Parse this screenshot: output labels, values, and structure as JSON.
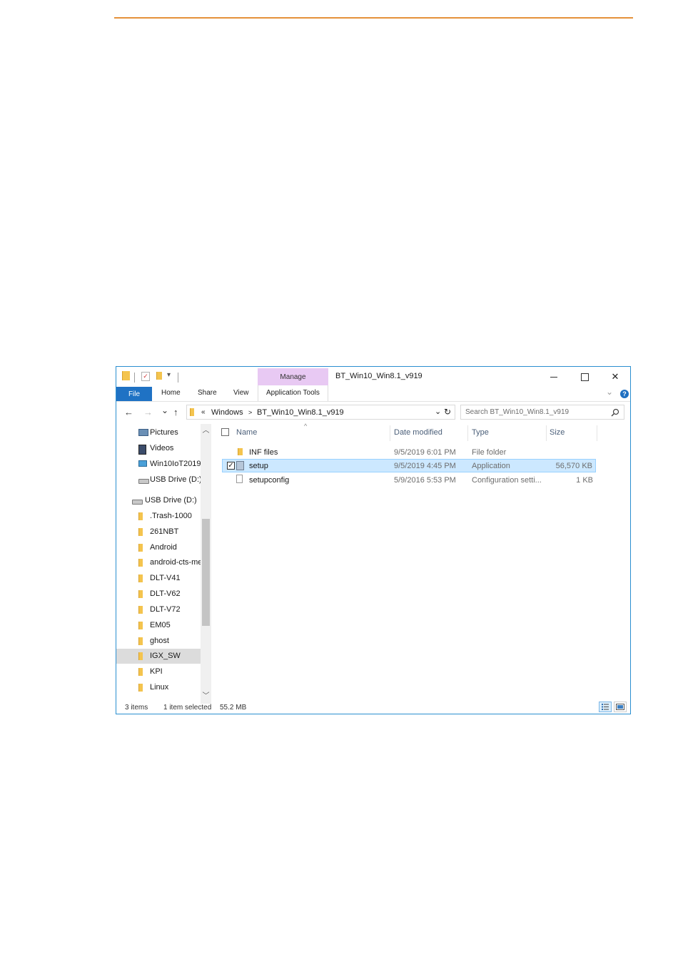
{
  "window": {
    "title": "BT_Win10_Win8.1_v919",
    "contextual_tab_group": "Manage",
    "ribbon_tabs": [
      "File",
      "Home",
      "Share",
      "View",
      "Application Tools"
    ],
    "help_label": "?"
  },
  "nav": {
    "back": "←",
    "forward": "→",
    "recent": "⌄",
    "up": "↑",
    "path_overflow": "«",
    "crumbs": [
      "Windows",
      "BT_Win10_Win8.1_v919"
    ],
    "crumb_sep": ">",
    "refresh": "↻",
    "search_placeholder": "Search BT_Win10_Win8.1_v919",
    "search_icon": "magnifier-icon"
  },
  "nav_pane": {
    "items": [
      {
        "label": "Pictures",
        "icon": "pictures-icon"
      },
      {
        "label": "Videos",
        "icon": "videos-icon"
      },
      {
        "label": "Win10IoT2019",
        "icon": "network-drive-icon"
      },
      {
        "label": "USB Drive (D:)",
        "icon": "usb-drive-icon"
      },
      {
        "label": "USB Drive (D:)",
        "icon": "usb-drive-icon"
      },
      {
        "label": ".Trash-1000",
        "icon": "folder-icon"
      },
      {
        "label": "261NBT",
        "icon": "folder-icon"
      },
      {
        "label": "Android",
        "icon": "folder-icon"
      },
      {
        "label": "android-cts-media",
        "icon": "folder-icon"
      },
      {
        "label": "DLT-V41",
        "icon": "folder-icon"
      },
      {
        "label": "DLT-V62",
        "icon": "folder-icon"
      },
      {
        "label": "DLT-V72",
        "icon": "folder-icon"
      },
      {
        "label": "EM05",
        "icon": "folder-icon"
      },
      {
        "label": "ghost",
        "icon": "folder-icon"
      },
      {
        "label": "IGX_SW",
        "icon": "folder-icon"
      },
      {
        "label": "KPI",
        "icon": "folder-icon"
      },
      {
        "label": "Linux",
        "icon": "folder-icon"
      }
    ],
    "selected": "IGX_SW"
  },
  "file_list": {
    "columns": [
      "Name",
      "Date modified",
      "Type",
      "Size"
    ],
    "rows": [
      {
        "name": "INF files",
        "date": "9/5/2019 6:01 PM",
        "type": "File folder",
        "size": "",
        "icon": "folder-icon"
      },
      {
        "name": "setup",
        "date": "9/5/2019 4:45 PM",
        "type": "Application",
        "size": "56,570 KB",
        "icon": "application-icon"
      },
      {
        "name": "setupconfig",
        "date": "5/9/2016 5:53 PM",
        "type": "Configuration setti...",
        "size": "1 KB",
        "icon": "config-file-icon"
      }
    ]
  },
  "status": {
    "items_count": "3 items",
    "selection": "1 item selected",
    "selection_size": "55.2 MB"
  },
  "colors": {
    "accent_rule": "#e5913a",
    "file_tab": "#1f72c4",
    "manage_band": "#e8c9f3",
    "selection_fill": "#cce8ff",
    "window_border": "#2b8fd0"
  }
}
